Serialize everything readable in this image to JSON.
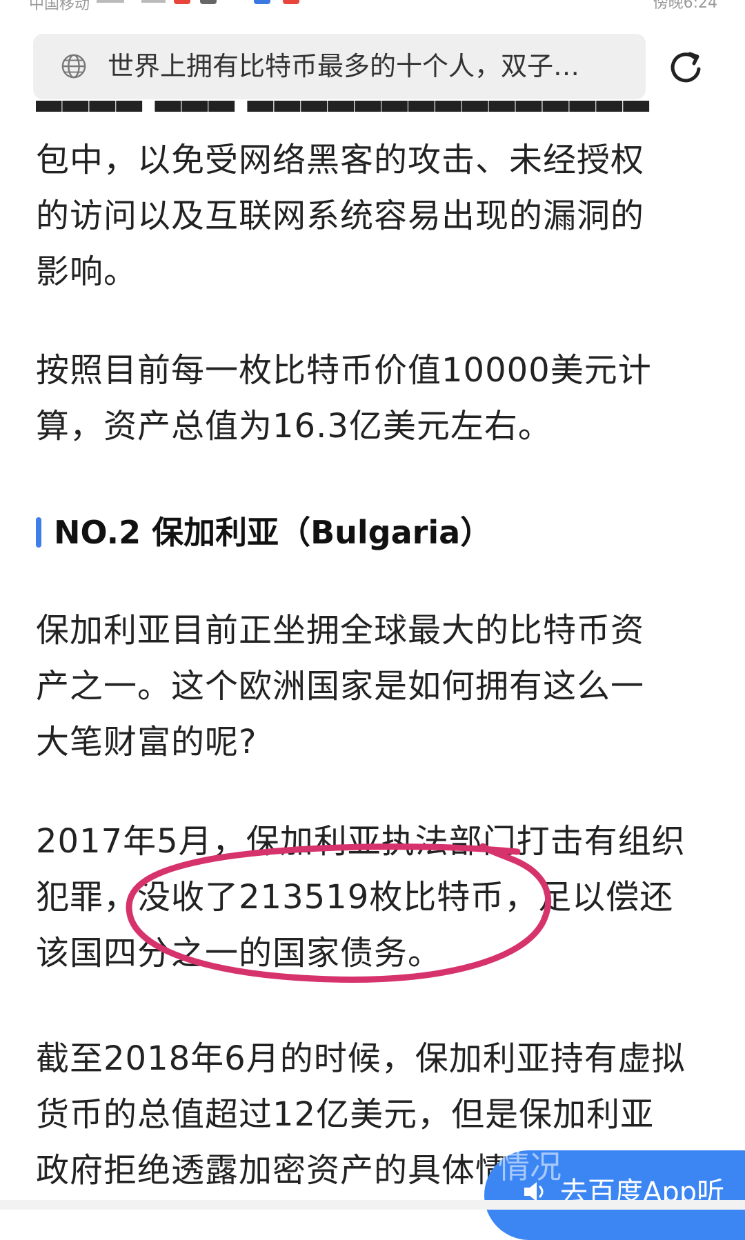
{
  "status_bar": {
    "carrier": "中国移动",
    "time": "傍晚6:24"
  },
  "address_bar": {
    "title": "世界上拥有比特币最多的十个人，双子…",
    "globe_icon": "globe-icon",
    "refresh_icon": "refresh-icon"
  },
  "article": {
    "p1": [
      "包中，以免受网络黑客的攻击、未经授权",
      "的访问以及互联网系统容易出现的漏洞的",
      "影响。"
    ],
    "p2": [
      "按照目前每一枚比特币价值10000美元计",
      "算，资产总值为16.3亿美元左右。"
    ],
    "heading": "NO.2 保加利亚（Bulgaria）",
    "p3": [
      "保加利亚目前正坐拥全球最大的比特币资",
      "产之一。这个欧洲国家是如何拥有这么一",
      "大笔财富的呢?"
    ],
    "p4": [
      "2017年5月，保加利亚执法部门打击有组织",
      "犯罪，没收了213519枚比特币，足以偿还",
      "该国四分之一的国家债务。"
    ],
    "p5": [
      "截至2018年6月的时候，保加利亚持有虚拟",
      "货币的总值超过12亿美元，但是保加利亚",
      "政府拒绝透露加密资产的具体情况。"
    ]
  },
  "listen_button": {
    "label": "去百度App听",
    "overlay_text": "情况",
    "icon": "speaker-icon"
  },
  "colors": {
    "accent": "#3f7ee8",
    "annotation": "#d6336c",
    "button": "#3c86f4"
  }
}
